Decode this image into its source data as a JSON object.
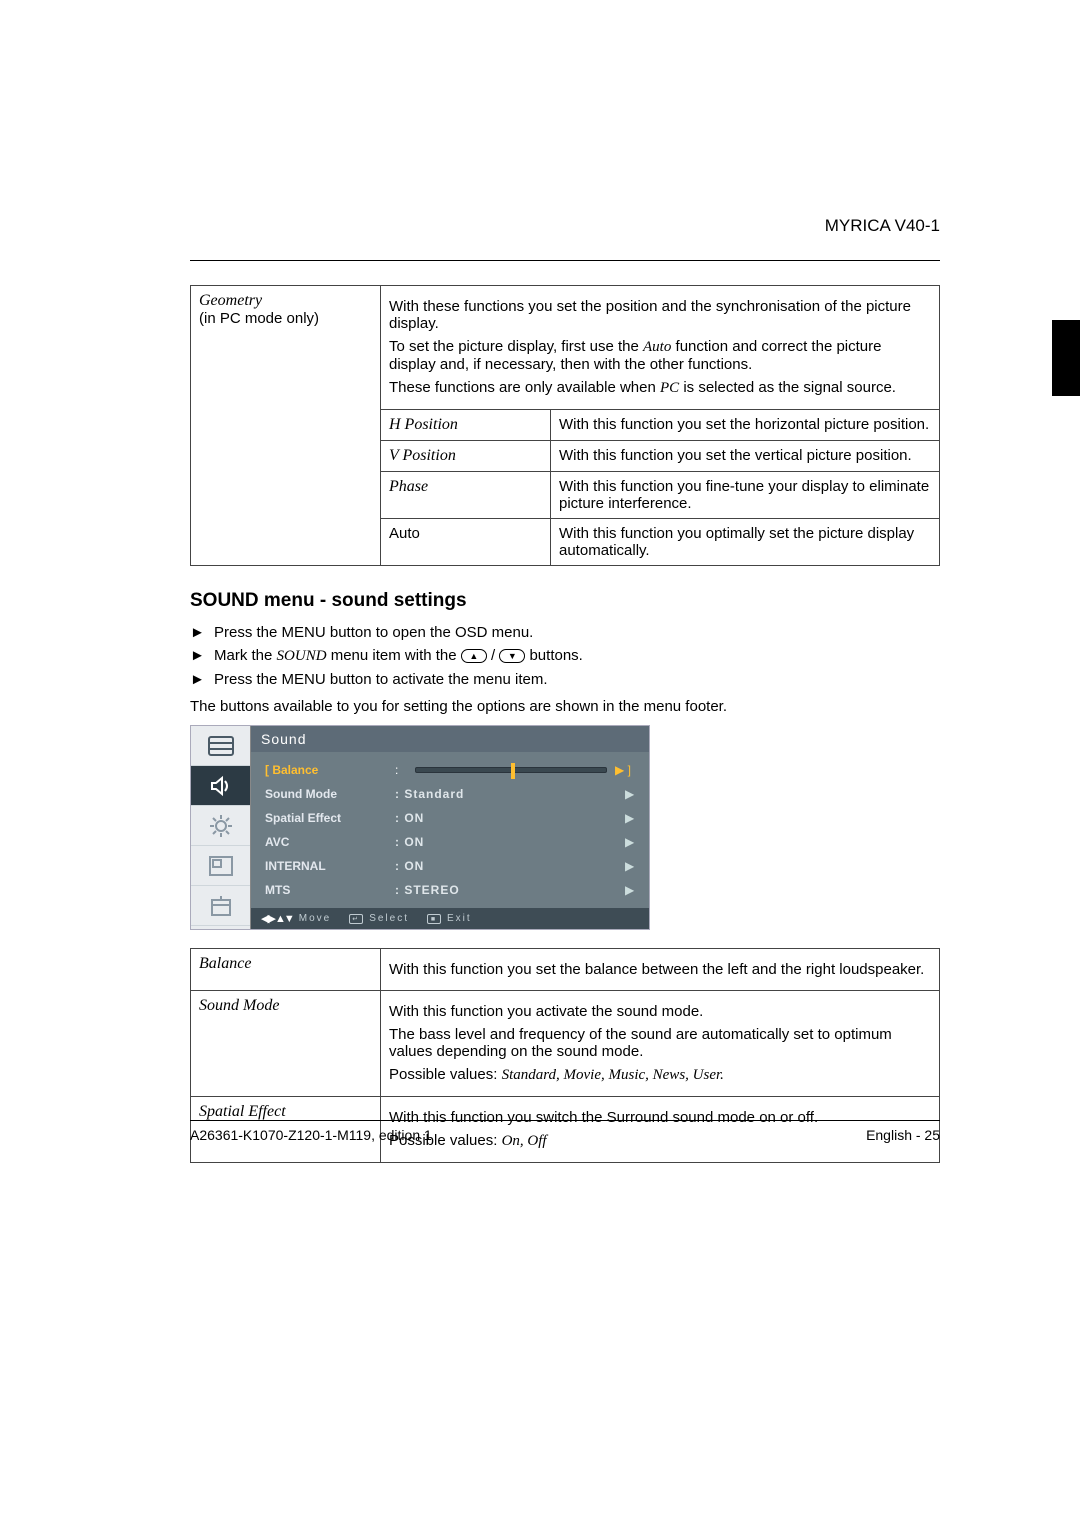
{
  "header": {
    "title": "MYRICA V40-1"
  },
  "geom": {
    "left_title": "Geometry",
    "left_sub": "(in PC mode only)",
    "intro1": "With these functions you set the position and the synchronisation of the picture display.",
    "intro2_a": "To set the picture display, first use the ",
    "intro2_auto": "Auto",
    "intro2_b": " function and correct the picture display and, if necessary, then with the other functions.",
    "intro3_a": "These functions are only available when ",
    "intro3_pc": "PC",
    "intro3_b": " is selected as the signal source.",
    "rows": [
      {
        "label": "H Position",
        "label_italic": true,
        "desc": "With this function you set the horizontal picture position."
      },
      {
        "label": "V Position",
        "label_italic": true,
        "desc": "With this function you set the vertical picture position."
      },
      {
        "label": "Phase",
        "label_italic": true,
        "desc": "With this function you fine-tune your display to eliminate picture interference."
      },
      {
        "label": "Auto",
        "label_italic": false,
        "desc": "With this function you optimally set the picture display automatically."
      }
    ]
  },
  "heading": "SOUND menu - sound settings",
  "bullets": {
    "b1": "Press the MENU button to open the OSD menu.",
    "b2_a": "Mark the ",
    "b2_it": "SOUND",
    "b2_b": " menu item with the ",
    "b2_c": " buttons.",
    "b3": "Press the MENU button to activate the menu item."
  },
  "note": "The buttons available to you for setting the options are shown in the menu footer.",
  "osd": {
    "title": "Sound",
    "rows": [
      {
        "label": "Balance",
        "value": "",
        "slider": true,
        "selected": true
      },
      {
        "label": "Sound Mode",
        "value": ": Standard",
        "slider": false,
        "selected": false
      },
      {
        "label": "Spatial Effect",
        "value": ": ON",
        "slider": false,
        "selected": false
      },
      {
        "label": "AVC",
        "value": ": ON",
        "slider": false,
        "selected": false
      },
      {
        "label": "INTERNAL",
        "value": ": ON",
        "slider": false,
        "selected": false
      },
      {
        "label": "MTS",
        "value": ": STEREO",
        "slider": false,
        "selected": false
      }
    ],
    "footer": {
      "move": "Move",
      "select": "Select",
      "exit": "Exit"
    }
  },
  "sound_def": [
    {
      "label": "Balance",
      "body": [
        {
          "t": "text",
          "v": "With this function you set the balance between the left and the right loudspeaker."
        }
      ]
    },
    {
      "label": "Sound Mode",
      "body": [
        {
          "t": "text",
          "v": "With this function you activate the sound mode."
        },
        {
          "t": "text",
          "v": "The bass level and frequency of the sound are automatically set to optimum values depending on the sound mode."
        },
        {
          "t": "pv",
          "prefix": "Possible values: ",
          "v": "Standard, Movie, Music, News, User."
        }
      ]
    },
    {
      "label": "Spatial Effect",
      "body": [
        {
          "t": "text",
          "v": "With this function you switch the Surround sound mode on or off."
        },
        {
          "t": "pv",
          "prefix": "Possible values: ",
          "v": "On, Off"
        }
      ]
    }
  ],
  "footer": {
    "left": "A26361-K1070-Z120-1-M119, edition 1",
    "right": "English - 25"
  }
}
